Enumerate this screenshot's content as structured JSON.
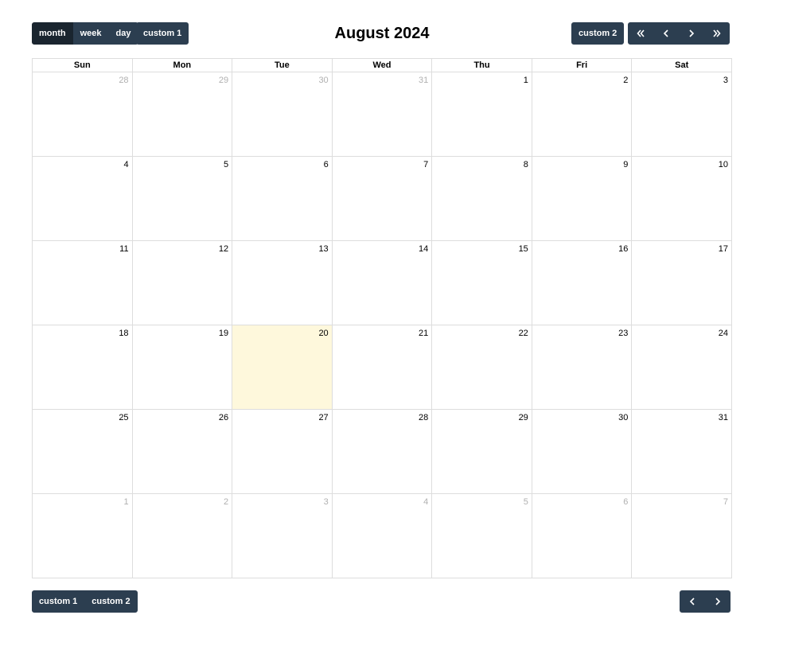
{
  "header": {
    "title": "August 2024",
    "views": [
      "month",
      "week",
      "day"
    ],
    "active_view": "month",
    "custom1_label": "custom 1",
    "custom2_label": "custom 2"
  },
  "footer": {
    "custom1_label": "custom 1",
    "custom2_label": "custom 2"
  },
  "weekdays": [
    "Sun",
    "Mon",
    "Tue",
    "Wed",
    "Thu",
    "Fri",
    "Sat"
  ],
  "weeks": [
    [
      {
        "d": "28",
        "o": true
      },
      {
        "d": "29",
        "o": true
      },
      {
        "d": "30",
        "o": true
      },
      {
        "d": "31",
        "o": true
      },
      {
        "d": "1"
      },
      {
        "d": "2"
      },
      {
        "d": "3"
      }
    ],
    [
      {
        "d": "4"
      },
      {
        "d": "5"
      },
      {
        "d": "6"
      },
      {
        "d": "7"
      },
      {
        "d": "8"
      },
      {
        "d": "9"
      },
      {
        "d": "10"
      }
    ],
    [
      {
        "d": "11"
      },
      {
        "d": "12"
      },
      {
        "d": "13"
      },
      {
        "d": "14"
      },
      {
        "d": "15"
      },
      {
        "d": "16"
      },
      {
        "d": "17"
      }
    ],
    [
      {
        "d": "18"
      },
      {
        "d": "19"
      },
      {
        "d": "20",
        "today": true
      },
      {
        "d": "21"
      },
      {
        "d": "22"
      },
      {
        "d": "23"
      },
      {
        "d": "24"
      }
    ],
    [
      {
        "d": "25"
      },
      {
        "d": "26"
      },
      {
        "d": "27"
      },
      {
        "d": "28"
      },
      {
        "d": "29"
      },
      {
        "d": "30"
      },
      {
        "d": "31"
      }
    ],
    [
      {
        "d": "1",
        "o": true
      },
      {
        "d": "2",
        "o": true
      },
      {
        "d": "3",
        "o": true
      },
      {
        "d": "4",
        "o": true
      },
      {
        "d": "5",
        "o": true
      },
      {
        "d": "6",
        "o": true
      },
      {
        "d": "7",
        "o": true
      }
    ]
  ],
  "colors": {
    "button_bg": "#2c3e50",
    "button_active_bg": "#1a252f",
    "today_bg": "#fef8dc",
    "other_month_text": "#b0b0b0"
  },
  "icons": {
    "prev_year": "double-chevron-left-icon",
    "prev": "chevron-left-icon",
    "next": "chevron-right-icon",
    "next_year": "double-chevron-right-icon"
  }
}
